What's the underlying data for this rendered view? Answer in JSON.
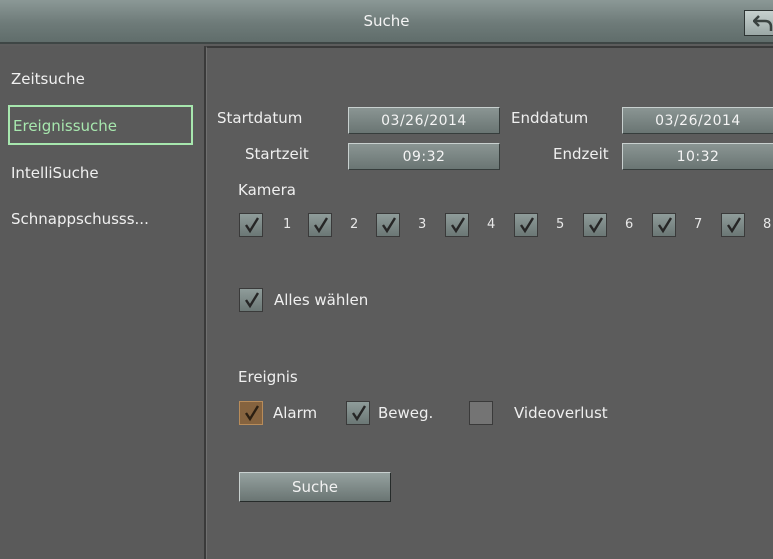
{
  "header": {
    "title": "Suche"
  },
  "sidebar": {
    "items": [
      {
        "label": "Zeitsuche",
        "active": false
      },
      {
        "label": "Ereignissuche",
        "active": true
      },
      {
        "label": "IntelliSuche",
        "active": false
      },
      {
        "label": "Schnappschusss...",
        "active": false
      }
    ]
  },
  "form": {
    "start_date_label": "Startdatum",
    "start_date_value": "03/26/2014",
    "end_date_label": "Enddatum",
    "end_date_value": "03/26/2014",
    "start_time_label": "Startzeit",
    "start_time_value": "09:32",
    "end_time_label": "Endzeit",
    "end_time_value": "10:32",
    "camera_label": "Kamera",
    "cameras": [
      {
        "number": "1",
        "checked": true
      },
      {
        "number": "2",
        "checked": true
      },
      {
        "number": "3",
        "checked": true
      },
      {
        "number": "4",
        "checked": true
      },
      {
        "number": "5",
        "checked": true
      },
      {
        "number": "6",
        "checked": true
      },
      {
        "number": "7",
        "checked": true
      },
      {
        "number": "8",
        "checked": true
      }
    ],
    "select_all_label": "Alles wählen",
    "select_all_checked": true,
    "event_label": "Ereignis",
    "events": [
      {
        "label": "Alarm",
        "checked": true
      },
      {
        "label": "Beweg.",
        "checked": true
      },
      {
        "label": "Videoverlust",
        "checked": false
      }
    ],
    "search_button_label": "Suche"
  },
  "icons": {
    "back": "back-arrow-icon",
    "check": "checkmark-icon"
  },
  "colors": {
    "active_item": "#a7e7ae",
    "alarm_checkbox": "#85633f"
  }
}
